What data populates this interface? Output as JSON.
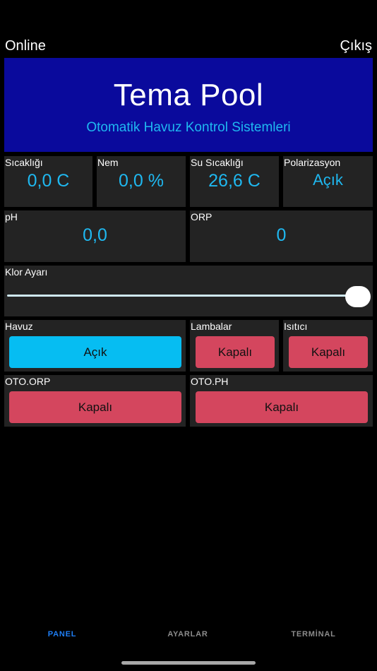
{
  "header": {
    "status": "Online",
    "logout_label": "Çıkış"
  },
  "banner": {
    "title": "Tema Pool",
    "subtitle": "Otomatik Havuz Kontrol Sistemleri"
  },
  "sensors": {
    "temp": {
      "label": "Sıcaklığı",
      "value": "0,0 C"
    },
    "humidity": {
      "label": "Nem",
      "value": "0,0 %"
    },
    "water_temp": {
      "label": "Su Sıcaklığı",
      "value": "26,6 C"
    },
    "polarization": {
      "label": "Polarizasyon",
      "value": "Açık"
    },
    "ph": {
      "label": "pH",
      "value": "0,0"
    },
    "orp": {
      "label": "ORP",
      "value": "0"
    }
  },
  "chlorine": {
    "label": "Klor Ayarı",
    "level_fraction": 1.0
  },
  "controls": {
    "havuz": {
      "label": "Havuz",
      "state": "Açık"
    },
    "lambalar": {
      "label": "Lambalar",
      "state": "Kapalı"
    },
    "isitici": {
      "label": "Isıtıcı",
      "state": "Kapalı"
    },
    "oto_orp": {
      "label": "OTO.ORP",
      "state": "Kapalı"
    },
    "oto_ph": {
      "label": "OTO.PH",
      "state": "Kapalı"
    }
  },
  "tabs": [
    {
      "label": "PANEL"
    },
    {
      "label": "AYARLAR"
    },
    {
      "label": "TERMİNAL"
    }
  ],
  "colors": {
    "accent": "#1fb8f0",
    "on": "#06bdf2",
    "off": "#d4465e",
    "banner": "#0a0a9c",
    "card": "#232323",
    "tab_active": "#1e7ef5"
  }
}
